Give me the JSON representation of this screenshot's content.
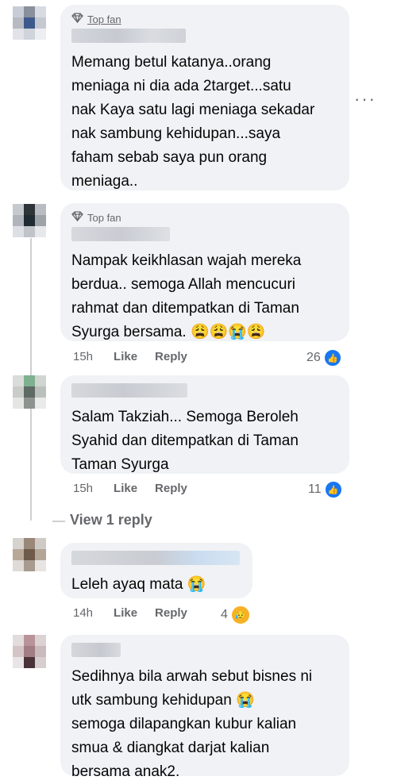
{
  "more_options_icon": "ellipsis-icon",
  "view_replies_label": "View 1 reply",
  "comments": [
    {
      "badge": "Top fan",
      "badge_icon": "diamond-icon",
      "text": "Memang betul katanya..orang\nmeniaga ni dia ada 2target...satu\nnak Kaya satu lagi meniaga sekadar\nnak sambung kehidupan...saya\nfaham sebab saya pun orang\nmeniaga.."
    },
    {
      "badge": "Top fan",
      "badge_icon": "diamond-icon",
      "text": "Nampak keikhlasan wajah mereka\nberdua.. semoga Allah mencucuri\nrahmat dan ditempatkan di Taman\nSyurga bersama. 😩😩😭😩",
      "time": "15h",
      "like_label": "Like",
      "reply_label": "Reply",
      "reaction_count": "26",
      "reaction_icon": "like-icon"
    },
    {
      "text": "Salam Takziah... Semoga Beroleh\nSyahid dan ditempatkan di Taman\nTaman Syurga",
      "time": "15h",
      "like_label": "Like",
      "reply_label": "Reply",
      "reaction_count": "11",
      "reaction_icon": "like-icon"
    },
    {
      "text": "Leleh ayaq mata 😭",
      "time": "14h",
      "like_label": "Like",
      "reply_label": "Reply",
      "reaction_count": "4",
      "reaction_icon": "sad-icon"
    },
    {
      "text": "Sedihnya bila arwah sebut bisnes ni\nutk sambung kehidupan 😭\nsemoga dilapangkan kubur kalian\nsmua & diangkat darjat kalian\nbersama anak2."
    }
  ]
}
